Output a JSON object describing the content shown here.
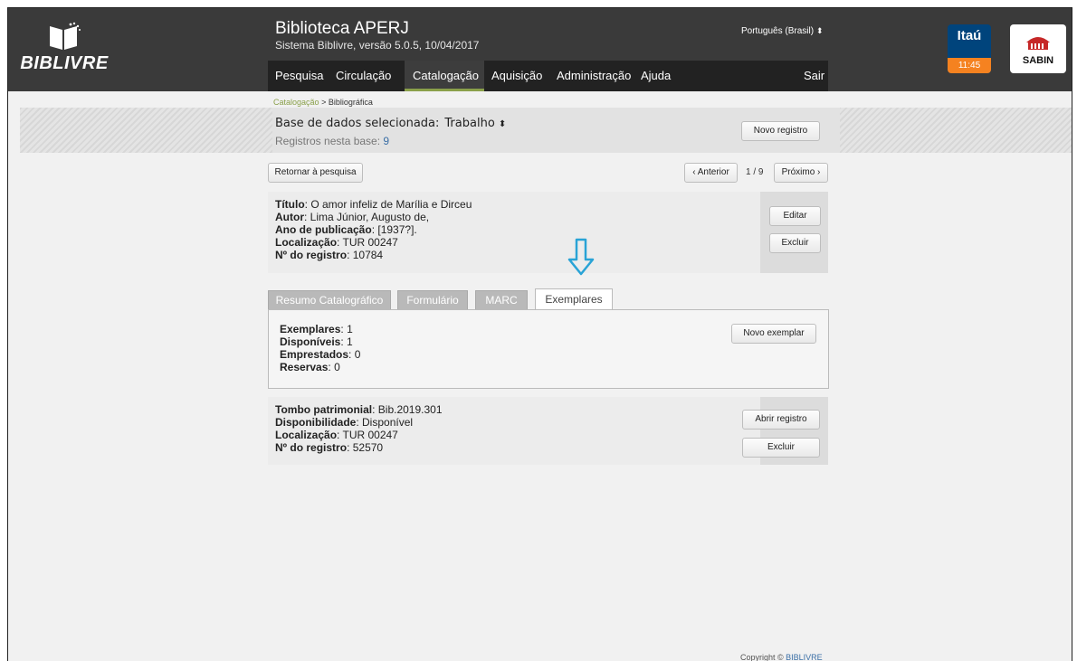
{
  "header": {
    "logo_text": "BIBLIVRE",
    "title": "Biblioteca APERJ",
    "subtitle": "Sistema Biblivre, versão 5.0.5, 10/04/2017",
    "language": "Português (Brasil)"
  },
  "nav": {
    "items": [
      "Pesquisa",
      "Circulação",
      "Catalogação",
      "Aquisição",
      "Administração",
      "Ajuda"
    ],
    "active": "Catalogação",
    "logout": "Sair"
  },
  "sponsors": {
    "itau_name": "Itaú",
    "itau_time": "11:45",
    "sabin_name": "SABIN"
  },
  "breadcrumb": {
    "link": "Catalogação",
    "separator": ">",
    "current": "Bibliográfica"
  },
  "database": {
    "label": "Base de dados selecionada:",
    "value": "Trabalho",
    "count_label": "Registros nesta base:",
    "count": "9",
    "new_record": "Novo registro"
  },
  "pager": {
    "back": "Retornar à pesquisa",
    "prev": "‹ Anterior",
    "position": "1 / 9",
    "next": "Próximo ›"
  },
  "record": {
    "title_label": "Título",
    "title": "O amor infeliz de Marília e Dirceu",
    "author_label": "Autor",
    "author": "Lima Júnior, Augusto de,",
    "year_label": "Ano de publicação",
    "year": "[1937?].",
    "location_label": "Localização",
    "location": "TUR 00247",
    "regnum_label": "Nº do registro",
    "regnum": "10784",
    "edit": "Editar",
    "delete": "Excluir"
  },
  "tabs": [
    {
      "label": "Resumo Catalográfico",
      "active": false
    },
    {
      "label": "Formulário",
      "active": false
    },
    {
      "label": "MARC",
      "active": false
    },
    {
      "label": "Exemplares",
      "active": true
    }
  ],
  "holdings_summary": {
    "copies_label": "Exemplares",
    "copies": "1",
    "available_label": "Disponíveis",
    "available": "1",
    "loaned_label": "Emprestados",
    "loaned": "0",
    "reserved_label": "Reservas",
    "reserved": "0",
    "new_copy": "Novo exemplar"
  },
  "holding": {
    "tombo_label": "Tombo patrimonial",
    "tombo": "Bib.2019.301",
    "availability_label": "Disponibilidade",
    "availability": "Disponível",
    "location_label": "Localização",
    "location": "TUR 00247",
    "regnum_label": "Nº do registro",
    "regnum": "52570",
    "open": "Abrir registro",
    "delete": "Excluir"
  },
  "footer": {
    "prefix": "Copyright ©",
    "brand": "BIBLIVRE"
  },
  "colors": {
    "header_bg": "#3a3a3a",
    "nav_bg": "#222222",
    "accent_green": "#8aa04a",
    "link_blue": "#3b6fa6",
    "arrow_blue": "#29a3d6"
  }
}
